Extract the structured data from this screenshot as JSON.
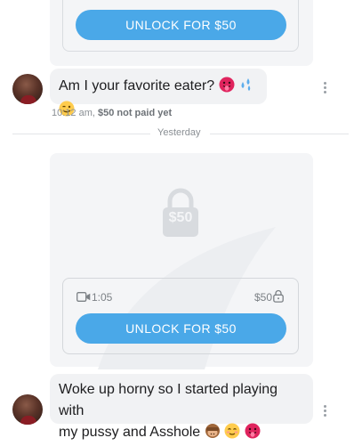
{
  "top_card": {
    "unlock_label": "UNLOCK FOR $50"
  },
  "message1": {
    "text": "Am I your favorite eater?",
    "emojis": [
      "tongue-face",
      "sweat-droplets",
      "winking-face"
    ],
    "time": "10:12 am,",
    "status": "$50 not paid yet"
  },
  "divider": {
    "label": "Yesterday"
  },
  "locked_post": {
    "lock_price": "$50",
    "video_duration": "1:05",
    "price": "$50",
    "unlock_label": "UNLOCK FOR $50"
  },
  "message2": {
    "line1": "Woke up horny so I started playing with",
    "line2": "my pussy and Asshole",
    "emojis": [
      "see-no-evil-monkey",
      "blushing-face",
      "tongue-face"
    ]
  },
  "colors": {
    "accent": "#4aa8e8",
    "bubble": "#f1f2f4",
    "card": "#f4f5f7"
  }
}
